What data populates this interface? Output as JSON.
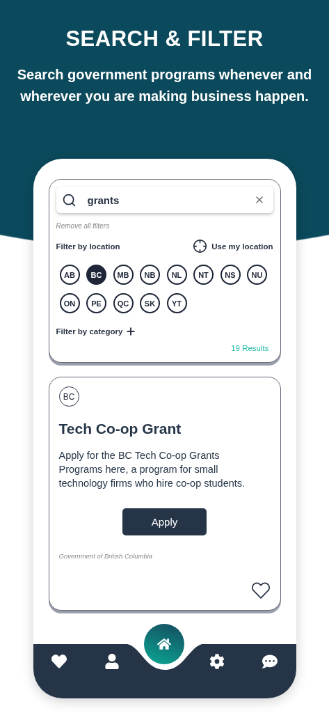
{
  "header": {
    "title": "SEARCH & FILTER",
    "subtitle": "Search government programs whenever and wherever you are making business happen."
  },
  "search": {
    "value": "grants"
  },
  "remove_filters": "Remove all filters",
  "location": {
    "label": "Filter by location",
    "use_location": "Use my location",
    "provinces": [
      {
        "label": "AB",
        "selected": false
      },
      {
        "label": "BC",
        "selected": true
      },
      {
        "label": "MB",
        "selected": false
      },
      {
        "label": "NB",
        "selected": false
      },
      {
        "label": "NL",
        "selected": false
      },
      {
        "label": "NT",
        "selected": false
      },
      {
        "label": "NS",
        "selected": false
      },
      {
        "label": "NU",
        "selected": false
      },
      {
        "label": "ON",
        "selected": false
      },
      {
        "label": "PE",
        "selected": false
      },
      {
        "label": "QC",
        "selected": false
      },
      {
        "label": "SK",
        "selected": false
      },
      {
        "label": "YT",
        "selected": false
      }
    ]
  },
  "category": {
    "label": "Filter by category"
  },
  "results": "19 Results",
  "program": {
    "province": "BC",
    "title": "Tech Co-op Grant",
    "description": "Apply for the BC Tech Co-op Grants Programs here, a program for small technology firms who hire co-op students.",
    "button": "Apply",
    "source": "Government of British Columbia",
    "favorite": false
  },
  "nav": [
    {
      "kind": "favorites",
      "selected": false
    },
    {
      "kind": "profile",
      "selected": false
    },
    {
      "kind": "home",
      "selected": true
    },
    {
      "kind": "settings",
      "selected": false
    },
    {
      "kind": "chat",
      "selected": false
    }
  ]
}
